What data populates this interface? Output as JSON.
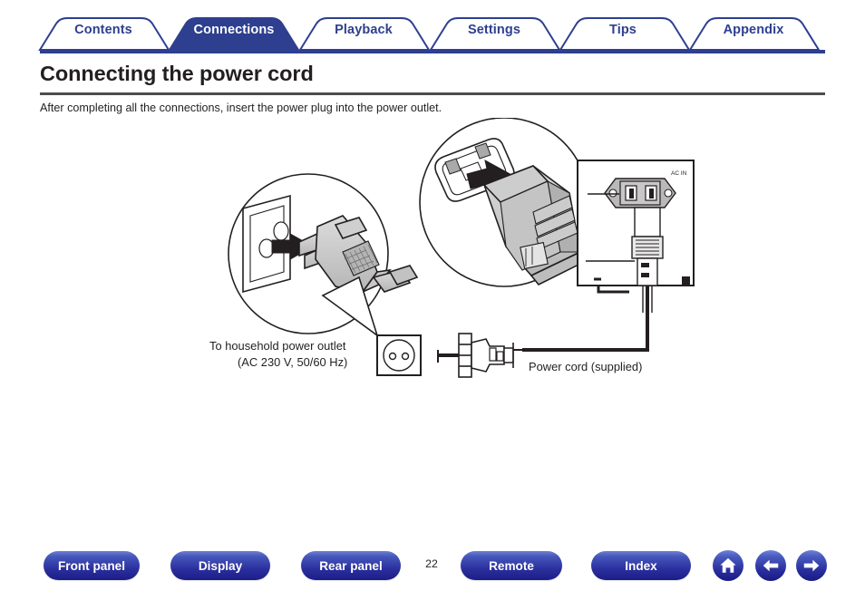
{
  "header": {
    "tabs": [
      {
        "label": "Contents",
        "active": false,
        "name": "tab-contents"
      },
      {
        "label": "Connections",
        "active": true,
        "name": "tab-connections"
      },
      {
        "label": "Playback",
        "active": false,
        "name": "tab-playback"
      },
      {
        "label": "Settings",
        "active": false,
        "name": "tab-settings"
      },
      {
        "label": "Tips",
        "active": false,
        "name": "tab-tips"
      },
      {
        "label": "Appendix",
        "active": false,
        "name": "tab-appendix"
      }
    ],
    "active_tab": "Connections",
    "accent_color": "#2e3f8f"
  },
  "page": {
    "title": "Connecting the power cord",
    "intro": "After completing all the connections, insert the power plug into the power outlet."
  },
  "diagram": {
    "labels": {
      "outlet_line1": "To household power outlet",
      "outlet_line2": "(AC 230 V, 50/60 Hz)",
      "power_cord": "Power cord (supplied)",
      "ac_in": "AC IN"
    }
  },
  "footer": {
    "buttons": [
      {
        "label": "Front panel",
        "name": "front-panel-button"
      },
      {
        "label": "Display",
        "name": "display-button"
      },
      {
        "label": "Rear panel",
        "name": "rear-panel-button"
      },
      {
        "label": "Remote",
        "name": "remote-button"
      },
      {
        "label": "Index",
        "name": "index-button"
      }
    ],
    "page_number": "22",
    "icons": [
      {
        "name": "home-icon",
        "glyph": "home"
      },
      {
        "name": "arrow-left-icon",
        "glyph": "arrow-left"
      },
      {
        "name": "arrow-right-icon",
        "glyph": "arrow-right"
      }
    ]
  }
}
